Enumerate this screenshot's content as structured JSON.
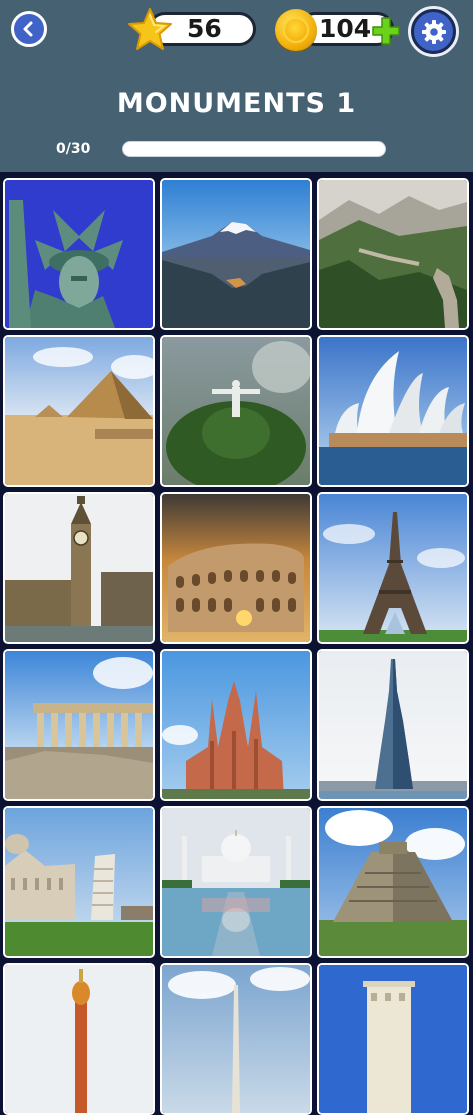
{
  "header": {
    "stars_count": "56",
    "coins_count": "104",
    "title": "MONUMENTS 1",
    "progress_text": "0/30",
    "progress_fraction": 0.0
  },
  "colors": {
    "header_bg": "#466172",
    "grid_bg": "#0b1232",
    "button_blue": "#3f63c6",
    "plus_green": "#6bd21b",
    "star_yellow": "#f7c41a",
    "coin_gold": "#f2b10c"
  },
  "icons": {
    "back": "chevron-left-icon",
    "stars": "star-icon",
    "coins": "coin-icon",
    "add": "plus-icon",
    "settings": "gear-icon"
  },
  "tiles": [
    {
      "subject": "statue-of-liberty"
    },
    {
      "subject": "mount-fuji"
    },
    {
      "subject": "great-wall"
    },
    {
      "subject": "pyramids"
    },
    {
      "subject": "christ-the-redeemer"
    },
    {
      "subject": "sydney-opera-house"
    },
    {
      "subject": "big-ben"
    },
    {
      "subject": "colosseum"
    },
    {
      "subject": "eiffel-tower"
    },
    {
      "subject": "parthenon"
    },
    {
      "subject": "sagrada-familia"
    },
    {
      "subject": "burj-khalifa"
    },
    {
      "subject": "leaning-tower-of-pisa"
    },
    {
      "subject": "taj-mahal"
    },
    {
      "subject": "chichen-itza"
    },
    {
      "subject": "st-basils-cathedral"
    },
    {
      "subject": "washington-monument"
    },
    {
      "subject": "belem-tower"
    }
  ]
}
